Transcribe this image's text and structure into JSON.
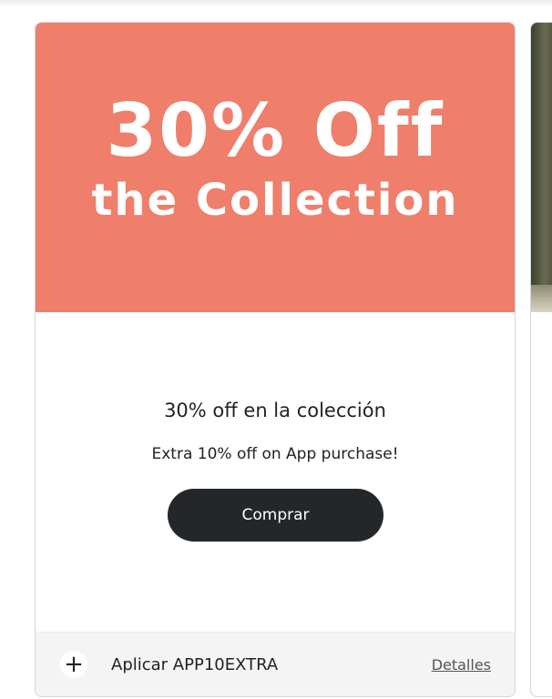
{
  "promo_card": {
    "banner": {
      "line1": "30% Off",
      "line2": "the Collection",
      "background_color": "#ef7e6b"
    },
    "title": "30% off en la colección",
    "subtitle": "Extra 10% off on App purchase!",
    "cta_label": "Comprar",
    "footer": {
      "plus_icon": "plus-icon",
      "plus_glyph": "+",
      "coupon_label": "Aplicar APP10EXTRA",
      "details_label": "Detalles"
    }
  },
  "colors": {
    "button_bg": "#23272a",
    "footer_bg": "#f4f4f4"
  }
}
